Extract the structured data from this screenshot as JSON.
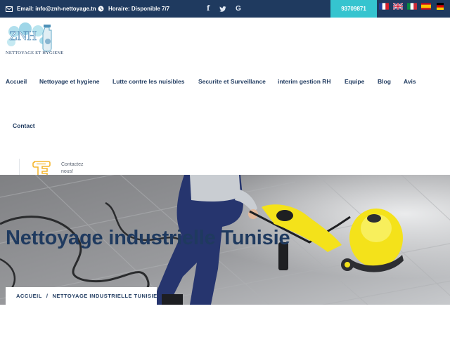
{
  "topbar": {
    "email": "Email: info@znh-nettoyage.tn",
    "hours": "Horaire: Disponible 7/7",
    "phone": "93709871",
    "social": [
      {
        "icon": "facebook-icon",
        "glyph": "f"
      },
      {
        "icon": "twitter-icon",
        "glyph": ""
      },
      {
        "icon": "google-icon",
        "glyph": "G"
      }
    ],
    "languages": [
      "French flag",
      "English flag",
      "Italian flag",
      "Spanish flag",
      "German flag"
    ]
  },
  "logo": {
    "text": "ZNH",
    "caption": "NETTOYAGE ET HYGIENE"
  },
  "nav": [
    {
      "label": "Accueil"
    },
    {
      "label": "Nettoyage et hygiene"
    },
    {
      "label": "Lutte contre les nuisibles"
    },
    {
      "label": "Securite et Surveillance"
    },
    {
      "label": "interim gestion RH"
    },
    {
      "label": "Equipe"
    },
    {
      "label": "Blog"
    },
    {
      "label": "Avis"
    },
    {
      "label": "Contact"
    }
  ],
  "contact": {
    "line1": "Contactez",
    "line2": "nous!"
  },
  "hero": {
    "title": "Nettoyage industrielle Tunisie"
  },
  "breadcrumb": {
    "home": "ACCUEIL",
    "separator": "/",
    "current": "NETTOYAGE INDUSTRIELLE TUNISIE"
  },
  "colors": {
    "navy": "#1f3a5f",
    "teal": "#35c4cf",
    "accent_yellow": "#f5c542"
  }
}
